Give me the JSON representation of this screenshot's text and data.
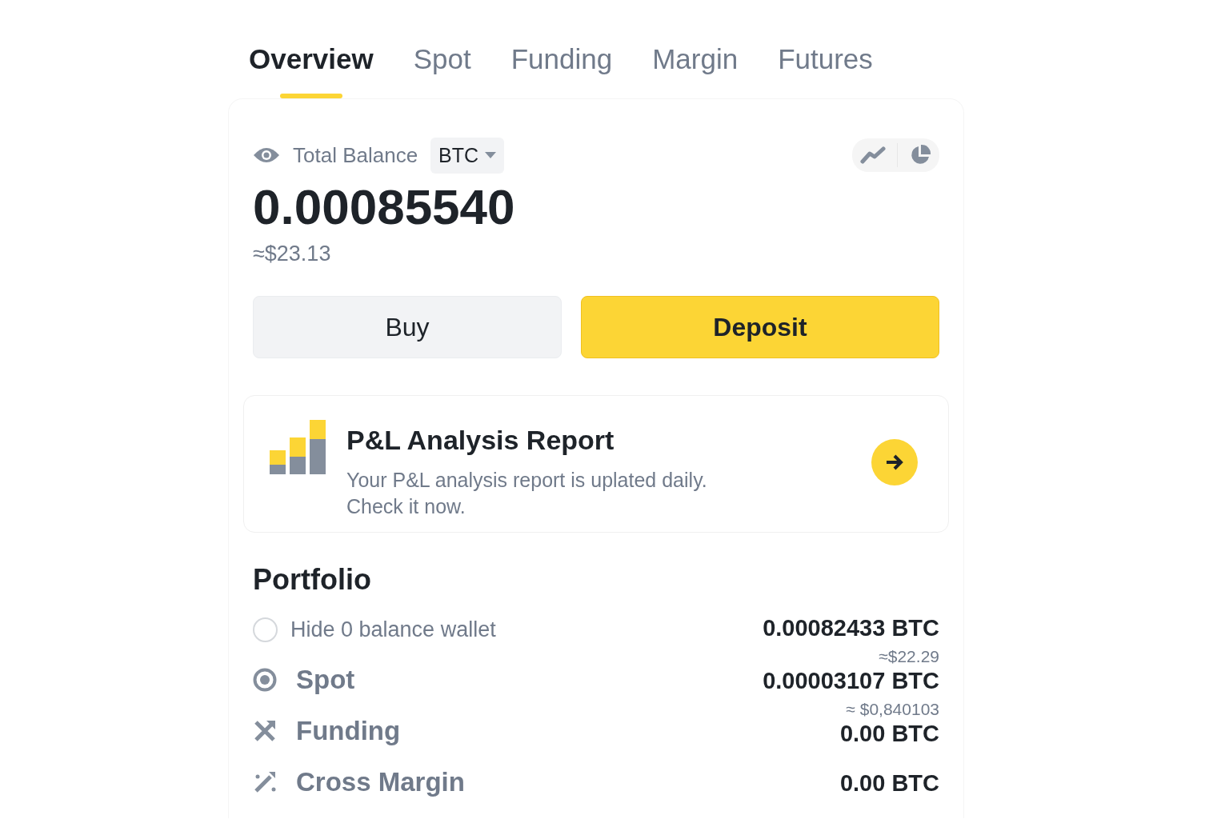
{
  "tabs": [
    {
      "label": "Overview",
      "selected": true
    },
    {
      "label": "Spot",
      "selected": false
    },
    {
      "label": "Funding",
      "selected": false
    },
    {
      "label": "Margin",
      "selected": false
    },
    {
      "label": "Futures",
      "selected": false
    }
  ],
  "balance": {
    "label": "Total Balance",
    "currency": "BTC",
    "amount": "0.00085540",
    "usd": "≈$23.13"
  },
  "buttons": [
    {
      "label": "Buy",
      "kind": "secondary"
    },
    {
      "label": "Deposit",
      "kind": "primary"
    }
  ],
  "promo": {
    "title": "P&L Analysis Report",
    "description": "Your P&L analysis report is uplated daily. Check it now."
  },
  "portfolio": {
    "title": "Portfolio",
    "hide_zero": {
      "label": "Hide 0 balance wallet",
      "checked": false
    },
    "wallets": [
      {
        "name": "Spot",
        "kind": "target"
      },
      {
        "name": "Funding",
        "kind": "cross"
      },
      {
        "name": "Cross Margin",
        "kind": "wand"
      }
    ],
    "amounts": [
      {
        "text": "0.00082433 BTC",
        "kind": "amount"
      },
      {
        "text": "≈$22.29",
        "kind": "usd"
      },
      {
        "text": "0.00003107 BTC",
        "kind": "amount"
      },
      {
        "text": "≈ $0,840103",
        "kind": "usd"
      },
      {
        "text": "0.00 BTC",
        "kind": "amount"
      },
      {
        "text": "0.00 BTC",
        "kind": "amount"
      }
    ]
  }
}
